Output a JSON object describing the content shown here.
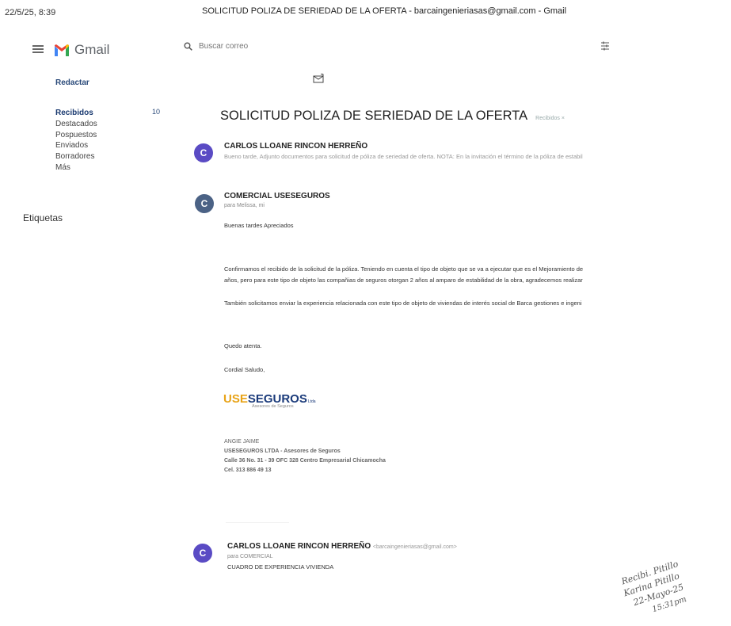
{
  "print_header": {
    "timestamp": "22/5/25, 8:39",
    "title": "SOLICITUD POLIZA DE SERIEDAD DE LA OFERTA - barcaingenieriasas@gmail.com - Gmail"
  },
  "app": {
    "name": "Gmail"
  },
  "search": {
    "placeholder": "Buscar correo"
  },
  "sidebar": {
    "compose": "Redactar",
    "items": [
      {
        "label": "Recibidos",
        "count": "10",
        "active": true
      },
      {
        "label": "Destacados"
      },
      {
        "label": "Pospuestos"
      },
      {
        "label": "Enviados"
      },
      {
        "label": "Borradores"
      },
      {
        "label": "Más"
      }
    ],
    "labels_heading": "Etiquetas"
  },
  "thread": {
    "subject": "SOLICITUD POLIZA DE SERIEDAD DE LA OFERTA",
    "inbox_label": "Recibidos ×",
    "messages": [
      {
        "avatar_letter": "C",
        "avatar_color": "#5a4bc4",
        "sender": "CARLOS LLOANE RINCON HERREÑO",
        "snippet": "Bueno tarde, Adjunto documentos para solicitud de póliza de seriedad de oferta. NOTA: En la invitación el término de la póliza de estabil"
      },
      {
        "avatar_letter": "C",
        "avatar_color": "#4b6285",
        "sender": "COMERCIAL USESEGUROS",
        "to": "para Melissa, mi",
        "body": [
          "Buenas tardes Apreciados",
          "Confirmamos el recibido de la solicitud de la póliza. Teniendo en cuenta el tipo de objeto que se va a ejecutar que es el Mejoramiento de",
          "años, pero para este tipo de objeto las compañias de seguros otorgan 2 años al amparo de estabilidad de la obra, agradecemos realizar",
          "También solicitamos enviar la experiencia relacionada con este tipo de objeto de viviendas de interés social de Barca gestiones e ingeni",
          "Quedo atenta.",
          "Cordial Saludo,"
        ],
        "signature_logo": {
          "prefix": "USE",
          "main": "SEGUROS",
          "suffix": "Ltda",
          "tagline": "Asesores de Seguros"
        },
        "signature": [
          "ANGIE JAIME",
          "USESEGUROS LTDA - Asesores de Seguros",
          "Calle 36 No. 31 - 39 OFC 328 Centro Empresarial Chicamocha",
          "Cel. 313 886 49 13"
        ]
      },
      {
        "avatar_letter": "C",
        "avatar_color": "#5a4bc4",
        "sender": "CARLOS LLOANE RINCON HERREÑO",
        "sender_email": "<barcaingenieriasas@gmail.com>",
        "to": "para COMERCIAL",
        "body": "CUADRO DE EXPERIENCIA VIVIENDA"
      }
    ]
  },
  "handwritten_note": [
    "Recibi. Pitillo",
    "Karina Pitillo",
    "22-Mayo-25",
    "15:31pm"
  ],
  "colors": {
    "gmail_red": "#d93025",
    "link_blue": "#2a4a7a"
  }
}
